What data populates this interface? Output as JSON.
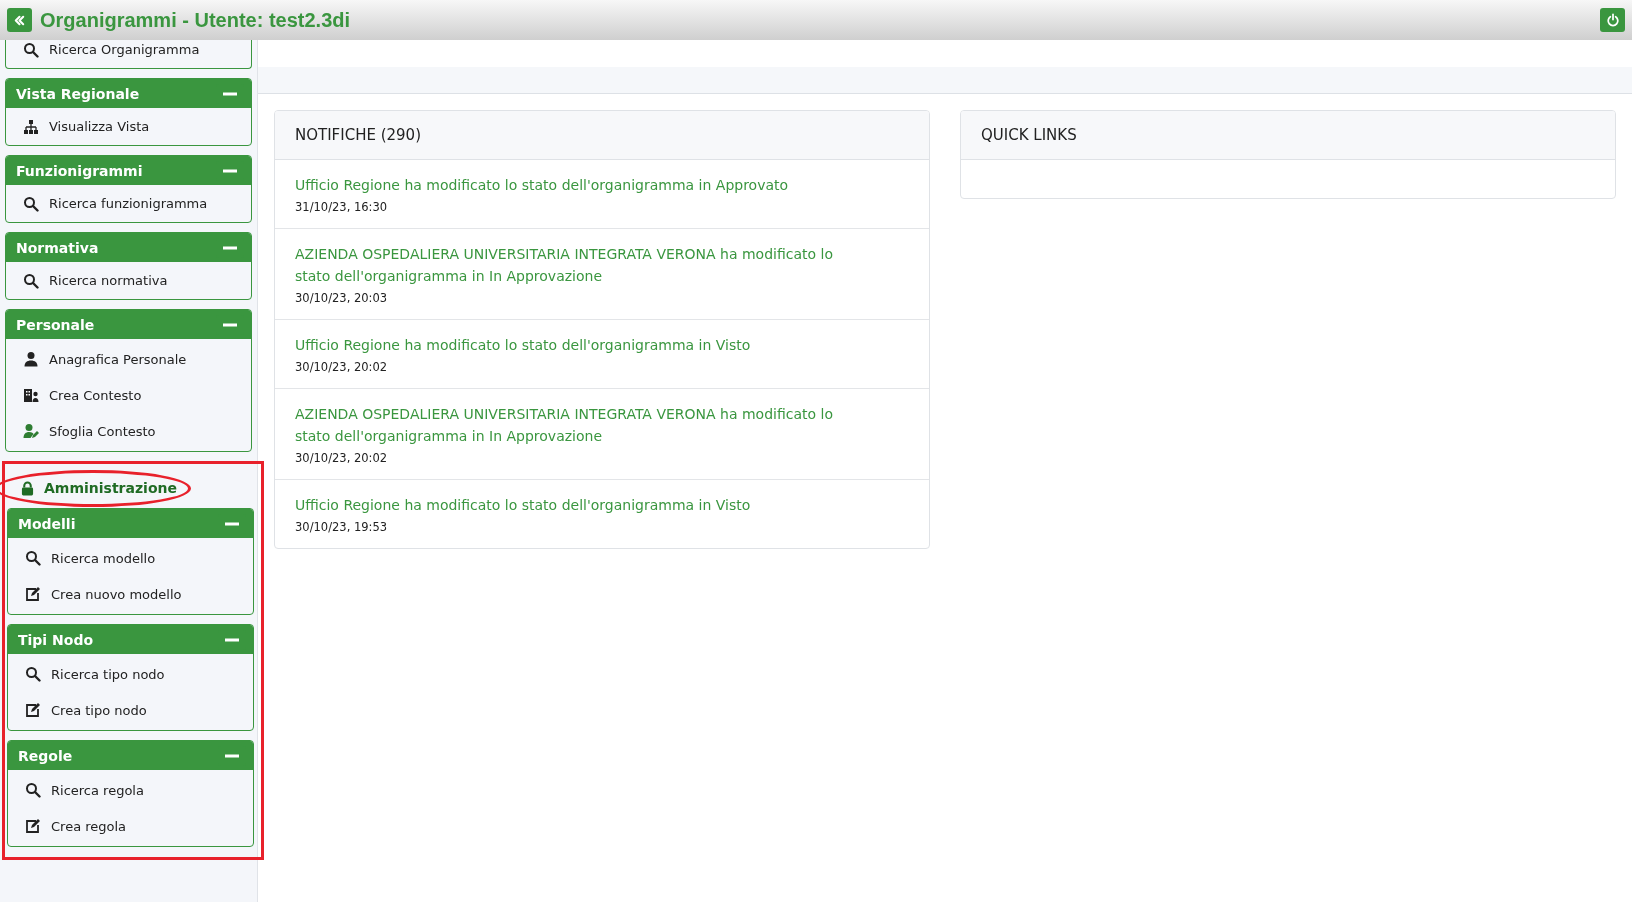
{
  "header": {
    "title": "Organigrammi - Utente: test2.3di"
  },
  "sidebar": {
    "groups": [
      {
        "items": [
          {
            "label": "Ricerca Organigramma",
            "kind": "search"
          }
        ]
      },
      {
        "title": "Vista Regionale",
        "expanded": true,
        "items": [
          {
            "label": "Visualizza Vista",
            "kind": "view"
          }
        ]
      },
      {
        "title": "Funzionigrammi",
        "expanded": true,
        "items": [
          {
            "label": "Ricerca funzionigramma",
            "kind": "search"
          }
        ]
      },
      {
        "title": "Normativa",
        "expanded": true,
        "items": [
          {
            "label": "Ricerca normativa",
            "kind": "search"
          }
        ]
      },
      {
        "title": "Personale",
        "expanded": true,
        "items": [
          {
            "label": "Anagrafica Personale",
            "kind": "person"
          },
          {
            "label": "Crea Contesto",
            "kind": "context"
          },
          {
            "label": "Sfoglia Contesto",
            "kind": "browse"
          }
        ]
      }
    ],
    "admin_section": {
      "label": "Amministrazione",
      "highlighted": true,
      "label_circled": true,
      "groups": [
        {
          "title": "Modelli",
          "expanded": true,
          "items": [
            {
              "label": "Ricerca modello",
              "kind": "search"
            },
            {
              "label": "Crea nuovo modello",
              "kind": "create"
            }
          ]
        },
        {
          "title": "Tipi Nodo",
          "expanded": true,
          "items": [
            {
              "label": "Ricerca tipo nodo",
              "kind": "search"
            },
            {
              "label": "Crea tipo nodo",
              "kind": "create"
            }
          ]
        },
        {
          "title": "Regole",
          "expanded": true,
          "items": [
            {
              "label": "Ricerca regola",
              "kind": "search"
            },
            {
              "label": "Crea regola",
              "kind": "create"
            }
          ]
        }
      ]
    }
  },
  "notifications": {
    "title": "NOTIFICHE (290)",
    "items": [
      {
        "text": "Ufficio Regione ha modificato lo stato dell'organigramma in Approvato",
        "time": "31/10/23, 16:30"
      },
      {
        "text": "AZIENDA OSPEDALIERA UNIVERSITARIA INTEGRATA VERONA ha modificato lo stato dell'organigramma in In Approvazione",
        "time": "30/10/23, 20:03"
      },
      {
        "text": "Ufficio Regione ha modificato lo stato dell'organigramma in Visto",
        "time": "30/10/23, 20:02"
      },
      {
        "text": "AZIENDA OSPEDALIERA UNIVERSITARIA INTEGRATA VERONA ha modificato lo stato dell'organigramma in In Approvazione",
        "time": "30/10/23, 20:02"
      },
      {
        "text": "Ufficio Regione ha modificato lo stato dell'organigramma in Visto",
        "time": "30/10/23, 19:53"
      }
    ]
  },
  "quick_links": {
    "title": "QUICK LINKS"
  }
}
